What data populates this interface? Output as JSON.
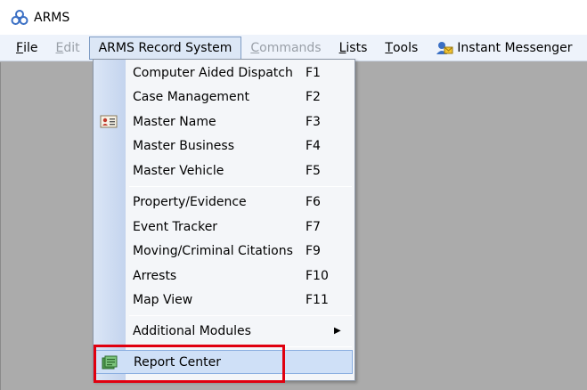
{
  "window": {
    "title": "ARMS"
  },
  "menubar": {
    "items": [
      {
        "pre": "",
        "u": "F",
        "post": "ile"
      },
      {
        "pre": "",
        "u": "E",
        "post": "dit"
      },
      {
        "pre": "ARMS Record System",
        "u": "",
        "post": ""
      },
      {
        "pre": "",
        "u": "C",
        "post": "ommands"
      },
      {
        "pre": "",
        "u": "L",
        "post": "ists"
      },
      {
        "pre": "",
        "u": "T",
        "post": "ools"
      },
      {
        "pre": "Instant Messenger",
        "u": "",
        "post": ""
      }
    ]
  },
  "dropdown": {
    "items": [
      {
        "label": "Computer Aided Dispatch",
        "key": "F1"
      },
      {
        "label": "Case Management",
        "key": "F2"
      },
      {
        "label": "Master Name",
        "key": "F3"
      },
      {
        "label": "Master Business",
        "key": "F4"
      },
      {
        "label": "Master Vehicle",
        "key": "F5"
      },
      {
        "label": "Property/Evidence",
        "key": "F6"
      },
      {
        "label": "Event Tracker",
        "key": "F7"
      },
      {
        "label": "Moving/Criminal Citations",
        "key": "F9"
      },
      {
        "label": "Arrests",
        "key": "F10"
      },
      {
        "label": "Map View",
        "key": "F11"
      },
      {
        "label": "Additional Modules",
        "key": ""
      },
      {
        "label": "Report Center",
        "key": ""
      }
    ]
  },
  "colors": {
    "highlight_box": "#e0000f",
    "menubar": "#eef3fb",
    "workarea": "#ababab"
  }
}
